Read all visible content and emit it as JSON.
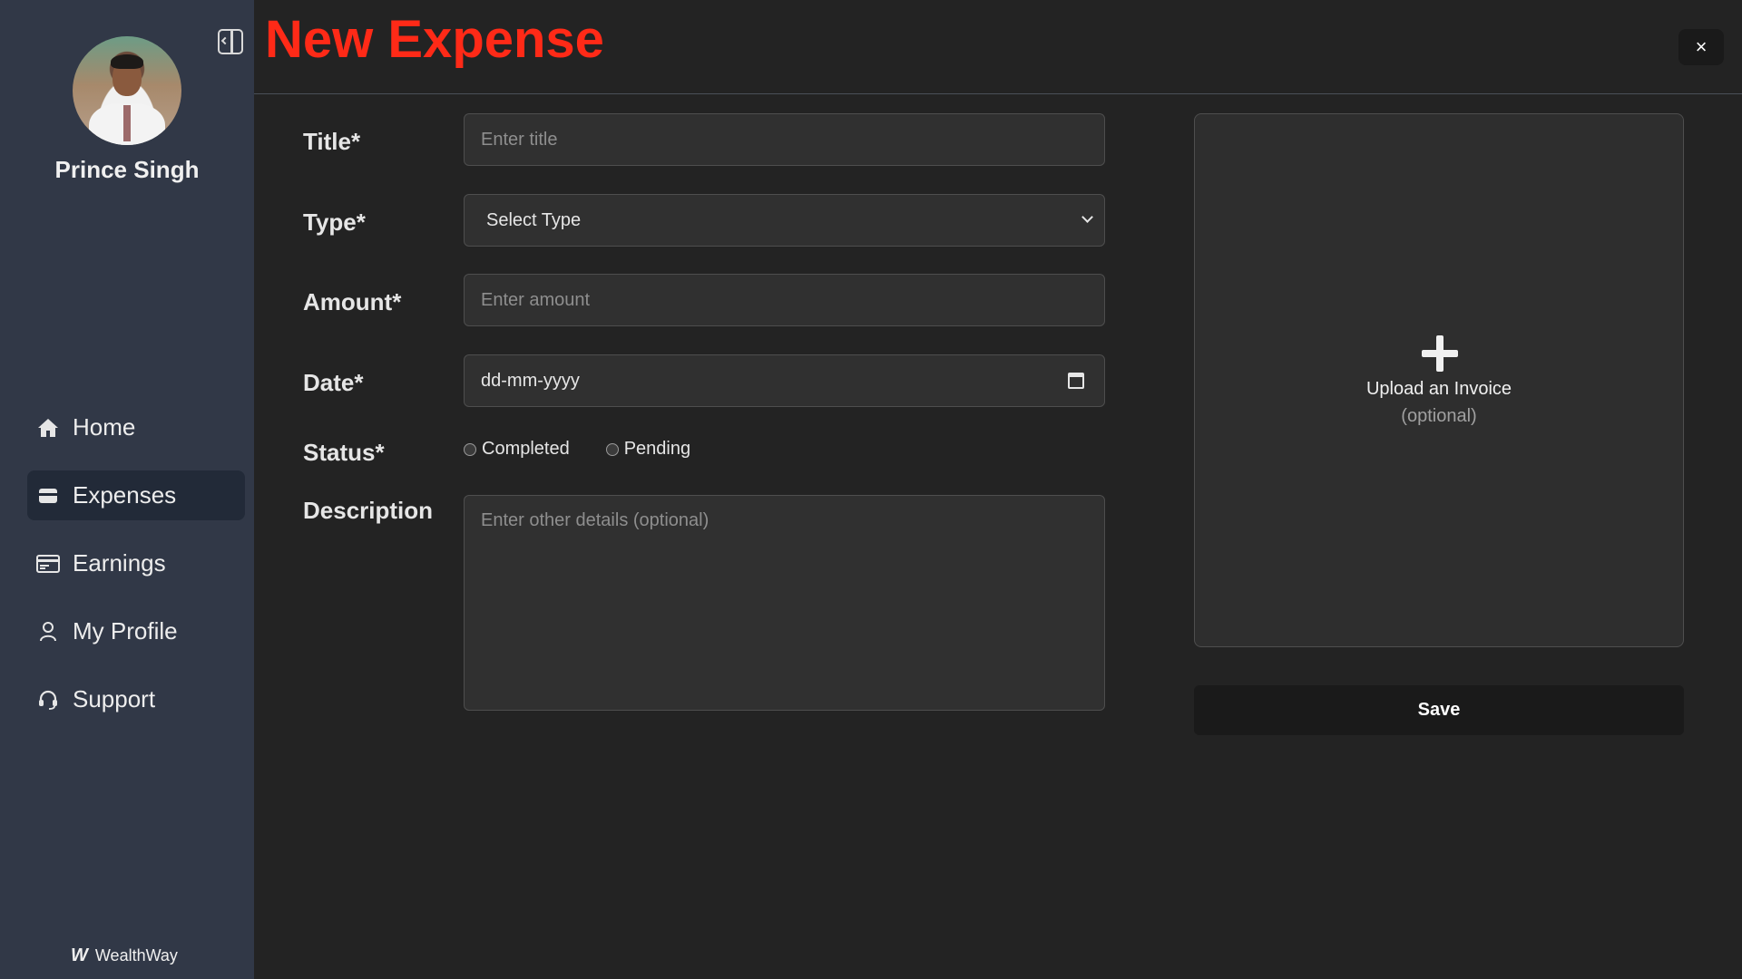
{
  "user": {
    "name": "Prince Singh"
  },
  "nav": {
    "items": [
      {
        "label": "Home",
        "icon": "home-icon"
      },
      {
        "label": "Expenses",
        "icon": "wallet-icon",
        "active": true
      },
      {
        "label": "Earnings",
        "icon": "card-icon"
      },
      {
        "label": "My Profile",
        "icon": "person-icon"
      },
      {
        "label": "Support",
        "icon": "headset-icon"
      }
    ]
  },
  "brand": {
    "logo": "W",
    "name": "WealthWay"
  },
  "header": {
    "title": "New Expense",
    "close_label": "×"
  },
  "form": {
    "title_label": "Title*",
    "title_placeholder": "Enter title",
    "type_label": "Type*",
    "type_value": "Select Type",
    "amount_label": "Amount*",
    "amount_placeholder": "Enter amount",
    "date_label": "Date*",
    "date_value": "dd-mm-yyyy",
    "status_label": "Status*",
    "status_options": [
      "Completed",
      "Pending"
    ],
    "description_label": "Description",
    "description_placeholder": "Enter other details (optional)"
  },
  "upload": {
    "label": "Upload an Invoice",
    "sub": "(optional)"
  },
  "save_label": "Save",
  "colors": {
    "accent": "#ff2a17",
    "sidebar": "#313847",
    "active_nav": "#222a38"
  }
}
